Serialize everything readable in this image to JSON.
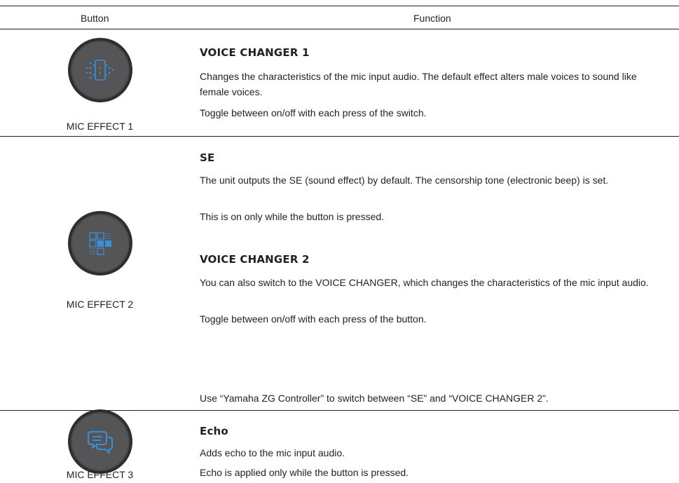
{
  "header": {
    "button_col": "Button",
    "function_col": "Function"
  },
  "rows": [
    {
      "caption": "MIC EFFECT 1",
      "icon": "voice-changer-icon",
      "sections": [
        {
          "heading": "VOICE CHANGER 1",
          "lines": [
            "Changes the characteristics of the mic input audio. The default effect alters male voices to sound like female voices.",
            "Toggle between on/off with each press of the switch."
          ]
        }
      ]
    },
    {
      "caption": "MIC EFFECT 2",
      "icon": "sound-effect-grid-icon",
      "sections": [
        {
          "heading": "SE",
          "lines": [
            "The unit outputs the SE (sound effect) by default. The censorship tone (electronic beep) is set.",
            "This is on only while the button is pressed."
          ]
        },
        {
          "heading": "VOICE CHANGER 2",
          "lines": [
            "You can also switch to the VOICE CHANGER, which changes the characteristics of the mic input audio.",
            "Toggle between on/off with each press of the button."
          ]
        }
      ],
      "note": "Use “Yamaha ZG Controller” to switch between “SE” and “VOICE CHANGER 2”."
    },
    {
      "caption": "MIC EFFECT 3",
      "icon": "echo-speech-bubbles-icon",
      "sections": [
        {
          "heading": "Echo",
          "lines": [
            "Adds echo to the mic input audio.",
            "Echo is applied only while the button is pressed."
          ]
        }
      ]
    }
  ],
  "colors": {
    "accent": "#3a8fd6",
    "button_face": "#4a4a4c",
    "rule": "#231f20"
  }
}
